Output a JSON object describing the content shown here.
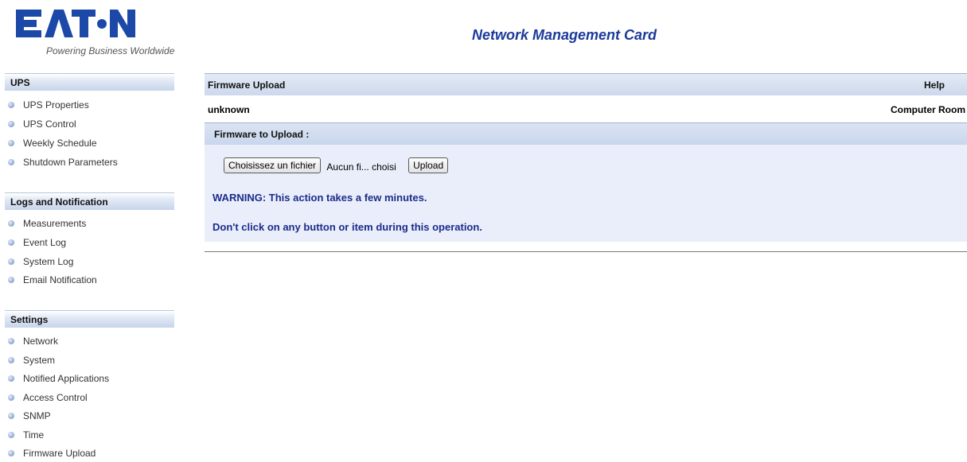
{
  "brand": {
    "logo_text": "EATON",
    "tagline": "Powering Business Worldwide",
    "logo_color": "#1c48a8"
  },
  "app": {
    "title": "Network Management Card"
  },
  "sidebar": {
    "sections": [
      {
        "title": "UPS",
        "items": [
          "UPS Properties",
          "UPS Control",
          "Weekly Schedule",
          "Shutdown Parameters"
        ]
      },
      {
        "title": "Logs and Notification",
        "items": [
          "Measurements",
          "Event Log",
          "System Log",
          "Email Notification"
        ]
      },
      {
        "title": "Settings",
        "items": [
          "Network",
          "System",
          "Notified Applications",
          "Access Control",
          "SNMP",
          "Time",
          "Firmware Upload"
        ]
      }
    ]
  },
  "main": {
    "page_title": "Firmware Upload",
    "help_label": "Help",
    "device_name": "unknown",
    "location": "Computer Room",
    "section_title": "Firmware to Upload :",
    "file_button_label": "Choisissez un fichier",
    "file_status": "Aucun fi... choisi",
    "upload_button_label": "Upload",
    "warning_line1": "WARNING: This action takes a few minutes.",
    "warning_line2": "Don't click on any button or item during this operation."
  },
  "colors": {
    "accent": "#1c3a9a",
    "warning_text": "#1c2b8a",
    "panel_bg": "#e9eefa"
  }
}
